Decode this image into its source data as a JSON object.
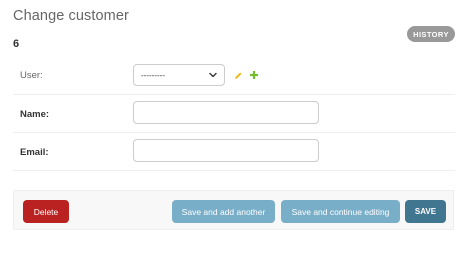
{
  "header": {
    "title": "Change customer",
    "object_id": "6",
    "history_label": "HISTORY"
  },
  "form": {
    "user": {
      "label": "User:",
      "selected": "---------",
      "edit_icon": "pencil-icon",
      "add_icon": "plus-icon"
    },
    "name": {
      "label": "Name:",
      "value": ""
    },
    "email": {
      "label": "Email:",
      "value": ""
    }
  },
  "actions": {
    "delete_label": "Delete",
    "save_add_another_label": "Save and add another",
    "save_continue_label": "Save and continue editing",
    "save_label": "SAVE"
  },
  "colors": {
    "history": "#999999",
    "delete": "#ba2121",
    "secondary_save": "#79aec8",
    "primary_save": "#417690",
    "edit_icon": "#efb80b",
    "add_icon": "#70bf2b"
  }
}
